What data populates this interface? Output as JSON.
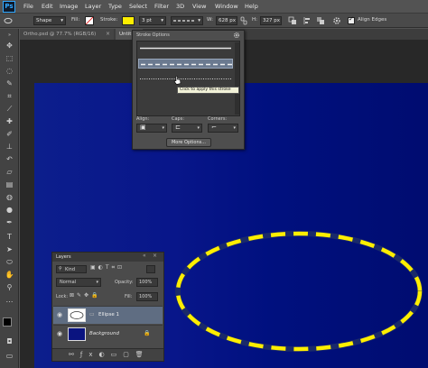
{
  "app": {
    "logo": "Ps"
  },
  "menu": [
    "File",
    "Edit",
    "Image",
    "Layer",
    "Type",
    "Select",
    "Filter",
    "3D",
    "View",
    "Window",
    "Help"
  ],
  "options_bar": {
    "mode": "Shape",
    "fill_label": "Fill:",
    "stroke_label": "Stroke:",
    "stroke_color": "#ffee00",
    "stroke_width": "3 pt",
    "w_label": "W:",
    "w_value": "628 px",
    "h_label": "H:",
    "h_value": "327 px",
    "align_edges": "Align Edges"
  },
  "tabs": [
    {
      "label": "Ortho.psd @ 77.7% (RGB/16)"
    },
    {
      "label": "Untit"
    }
  ],
  "stroke_panel": {
    "title": "Stroke Options",
    "tooltip": "Click to apply this stroke",
    "align_label": "Align:",
    "caps_label": "Caps:",
    "corners_label": "Corners:",
    "more_button": "More Options..."
  },
  "layers_panel": {
    "title": "Layers",
    "filter": "Kind",
    "blend_mode": "Normal",
    "opacity_label": "Opacity:",
    "opacity_value": "100%",
    "lock_label": "Lock:",
    "fill_label": "Fill:",
    "fill_value": "100%",
    "layers": [
      {
        "name": "Ellipse 1",
        "selected": true
      },
      {
        "name": "Background",
        "selected": false
      }
    ]
  },
  "colors": {
    "canvas": "#08168a",
    "dash": "#ffee00",
    "ui_bg": "#535353",
    "panel_bg": "#4e4e4e"
  }
}
